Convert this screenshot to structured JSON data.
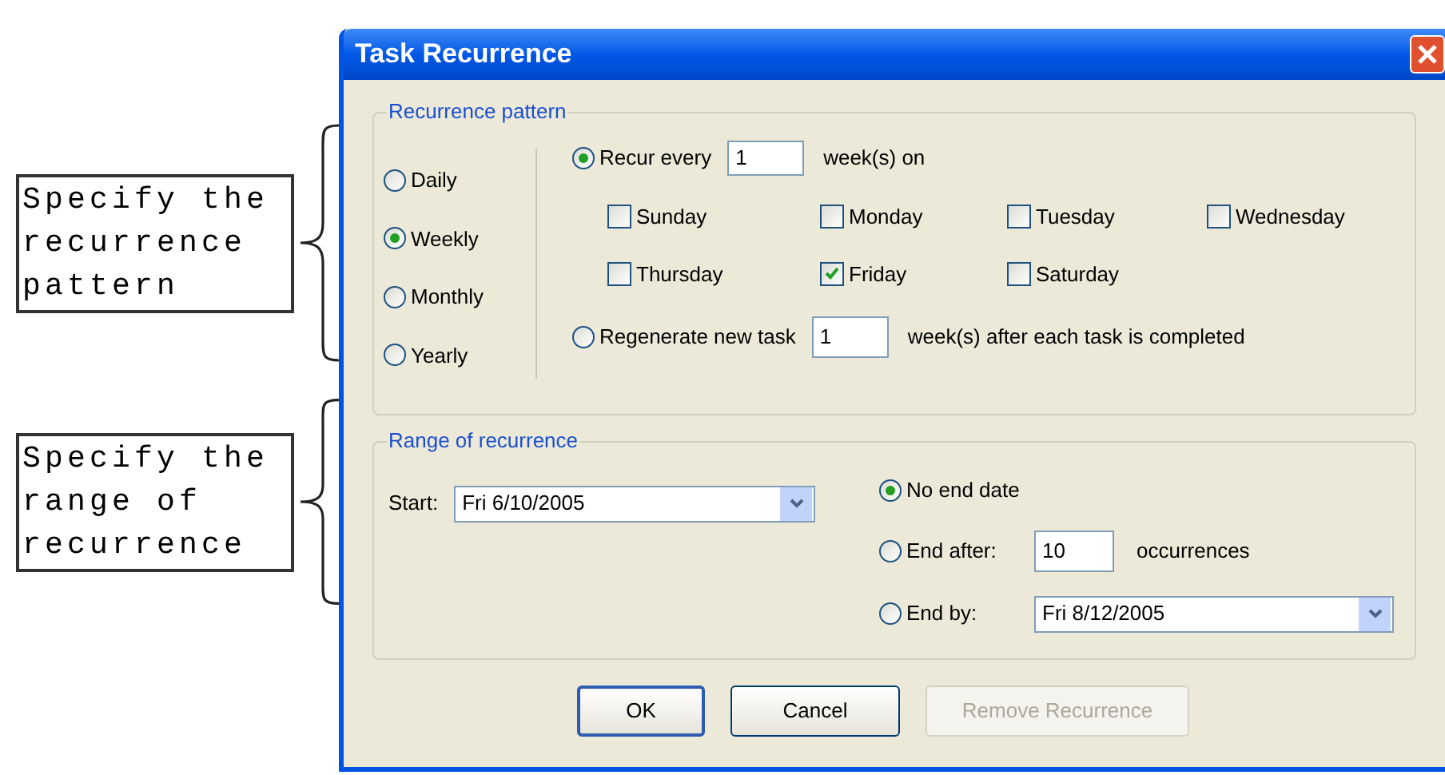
{
  "annotations": [
    {
      "text": "Specify the recurrence pattern"
    },
    {
      "text": "Specify the range of recurrence"
    }
  ],
  "window": {
    "title": "Task Recurrence"
  },
  "pattern": {
    "legend": "Recurrence pattern",
    "frequencies": [
      {
        "label": "Daily",
        "selected": false
      },
      {
        "label": "Weekly",
        "selected": true
      },
      {
        "label": "Monthly",
        "selected": false
      },
      {
        "label": "Yearly",
        "selected": false
      }
    ],
    "recur_every": {
      "selected": true,
      "label": "Recur every",
      "value": "1",
      "suffix": "week(s) on"
    },
    "days": [
      {
        "label": "Sunday",
        "checked": false
      },
      {
        "label": "Monday",
        "checked": false
      },
      {
        "label": "Tuesday",
        "checked": false
      },
      {
        "label": "Wednesday",
        "checked": false
      },
      {
        "label": "Thursday",
        "checked": false
      },
      {
        "label": "Friday",
        "checked": true
      },
      {
        "label": "Saturday",
        "checked": false
      }
    ],
    "regenerate": {
      "selected": false,
      "label": "Regenerate new task",
      "value": "1",
      "suffix": "week(s) after each task is completed"
    }
  },
  "range": {
    "legend": "Range of recurrence",
    "start": {
      "label": "Start:",
      "value": "Fri 6/10/2005"
    },
    "end_options": [
      {
        "kind": "none",
        "label": "No end date",
        "selected": true
      },
      {
        "kind": "after",
        "label": "End after:",
        "value": "10",
        "suffix": "occurrences",
        "selected": false
      },
      {
        "kind": "by",
        "label": "End by:",
        "value": "Fri 8/12/2005",
        "selected": false
      }
    ]
  },
  "buttons": [
    {
      "label": "OK",
      "disabled": false,
      "default": true
    },
    {
      "label": "Cancel",
      "disabled": false,
      "default": false
    },
    {
      "label": "Remove Recurrence",
      "disabled": true,
      "default": false
    }
  ]
}
